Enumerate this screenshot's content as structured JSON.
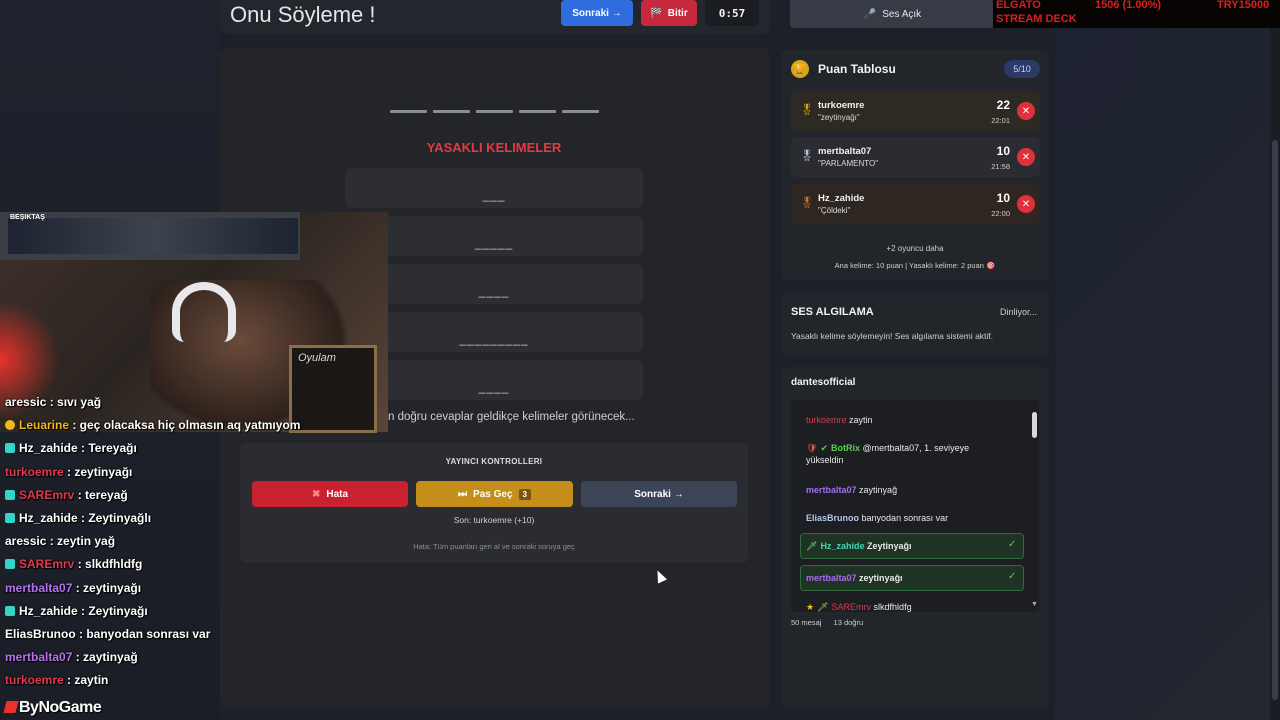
{
  "header": {
    "title": "Onu Söyleme !",
    "next_label": "Sonraki →",
    "finish_label": "Bitir",
    "finish_icon": "flag-icon",
    "timer": "0:57"
  },
  "game": {
    "word_dash_count": 5,
    "forbidden_title": "YASAKLI KELIMELER",
    "forbidden_words": [
      "___",
      "_____",
      "____",
      "_________",
      "____"
    ],
    "hint": "n doğru cevaplar geldikçe kelimeler görünecek..."
  },
  "controls": {
    "title": "YAYINCI KONTROLLERI",
    "error_label": "Hata",
    "pass_label": "Pas Geç",
    "pass_count": "3",
    "next_label": "Sonraki →",
    "last": "Son: turkoemre (+10)",
    "error_hint": "Hata: Tüm puanları geri al ve sonraki soruya geç"
  },
  "sound": {
    "label": "Ses Açık",
    "icon": "mic-icon"
  },
  "overlay": {
    "elgato": "ELGATO",
    "stream_deck": "STREAM DECK",
    "stat": "1506 (1.00%)",
    "donation": "TRY15000"
  },
  "scoreboard": {
    "title": "Puan Tablosu",
    "count": "5/10",
    "rows": [
      {
        "name": "turkoemre",
        "answer": "\"zeytinyağı\"",
        "points": "22",
        "time": "22:01",
        "medal_color": "#e0a01a",
        "bg": "#2c2a22"
      },
      {
        "name": "mertbalta07",
        "answer": "\"PARLAMENTO\"",
        "points": "10",
        "time": "21:58",
        "medal_color": "#b9c3d3",
        "bg": "#2a2c31"
      },
      {
        "name": "Hz_zahide",
        "answer": "\"Çöldeki\"",
        "points": "10",
        "time": "22:00",
        "medal_color": "#c4773b",
        "bg": "#2e2721"
      }
    ],
    "more": "+2 oyuncu daha",
    "rule": "Ana kelime: 10 puan | Yasaklı kelime: 2 puan 🎯"
  },
  "voice": {
    "title": "SES ALGILAMA",
    "status": "Dinliyor...",
    "desc": "Yasaklı kelime söylemeyin! Ses algılama sistemi aktif."
  },
  "chat": {
    "title": "dantesofficial",
    "messages": [
      {
        "user": "turkoemre",
        "color": "#d23a50",
        "text": "zaytin"
      },
      {
        "user": "BotRix",
        "color": "#56d14a",
        "text": "@mertbalta07, 1. seviyeye yükseldin"
      },
      {
        "user": "mertbalta07",
        "color": "#a56cf0",
        "text": "zaytinyağ"
      },
      {
        "user": "EliasBrunoo",
        "color": "#b7c7e8",
        "text": "banyodan sonrası var"
      },
      {
        "user": "Hz_zahide",
        "color": "#45d4b4",
        "text": "Zeytinyağı"
      },
      {
        "user": "mertbalta07",
        "color": "#a56cf0",
        "text": "zeytinyağı"
      },
      {
        "user": "SAREmrv",
        "color": "#d23a50",
        "text": "slkdfhldfg"
      }
    ],
    "footer_count": "50 mesaj",
    "footer_correct": "13 doğru"
  },
  "stream_chat": [
    {
      "user": "aressic",
      "color": "#ffffff",
      "text": " : sıvı yağ",
      "badge": ""
    },
    {
      "user": "Leuarine",
      "color": "#f0b81c",
      "text": " : geç olacaksa hiç olmasın aq yatmıyom",
      "badge": "y"
    },
    {
      "user": "Hz_zahide",
      "color": "#ffffff",
      "text": " : Tereyağı",
      "badge": "c"
    },
    {
      "user": "turkoemre",
      "color": "#e0394e",
      "text": " : zeytinyağı",
      "badge": ""
    },
    {
      "user": "SAREmrv",
      "color": "#e0394e",
      "text": " : tereyağ",
      "badge": "c"
    },
    {
      "user": "Hz_zahide",
      "color": "#ffffff",
      "text": " : Zeytinyağlı",
      "badge": "c"
    },
    {
      "user": "aressic",
      "color": "#ffffff",
      "text": " : zeytin yağ",
      "badge": ""
    },
    {
      "user": "SAREmrv",
      "color": "#e0394e",
      "text": " : slkdfhldfg",
      "badge": "c"
    },
    {
      "user": "mertbalta07",
      "color": "#b573f0",
      "text": " : zeytinyağı",
      "badge": ""
    },
    {
      "user": "Hz_zahide",
      "color": "#ffffff",
      "text": " : Zeytinyağı",
      "badge": "c"
    },
    {
      "user": "EliasBrunoo",
      "color": "#ffffff",
      "text": " : banyodan sonrası var",
      "badge": ""
    },
    {
      "user": "mertbalta07",
      "color": "#b573f0",
      "text": " : zaytinyağ",
      "badge": ""
    },
    {
      "user": "turkoemre",
      "color": "#e0394e",
      "text": " : zaytin",
      "badge": ""
    }
  ],
  "webcam": {
    "label": "BEŞIKTAŞ",
    "board_text": "Oyulam"
  },
  "logo": "ByNoGame"
}
